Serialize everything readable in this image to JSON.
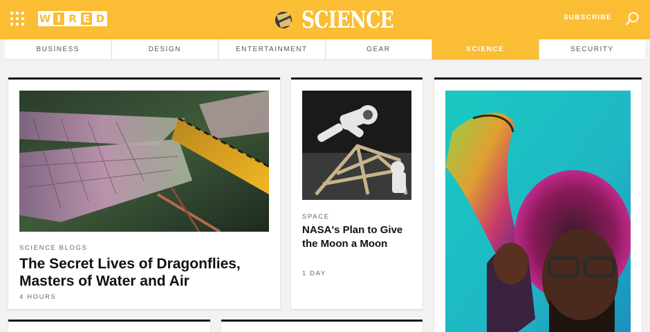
{
  "header": {
    "brand_letters": [
      "W",
      "I",
      "R",
      "E",
      "D"
    ],
    "section_title": "SCIENCE",
    "subscribe_label": "SUBSCRIBE",
    "brand_color": "#fbbd33"
  },
  "nav": {
    "items": [
      {
        "label": "BUSINESS"
      },
      {
        "label": "DESIGN"
      },
      {
        "label": "ENTERTAINMENT"
      },
      {
        "label": "GEAR"
      },
      {
        "label": "SCIENCE",
        "active": true
      },
      {
        "label": "SECURITY"
      }
    ]
  },
  "cards": [
    {
      "kicker": "SCIENCE BLOGS",
      "headline": "The Secret Lives of Dragonflies, Masters of Water and Air",
      "meta": "4 HOURS",
      "image": "dragonfly-closeup"
    },
    {
      "kicker": "SPACE",
      "headline": "NASA's Plan to Give the Moon a Moon",
      "meta": "1 DAY",
      "image": "astronaut-on-lunar-frame"
    },
    {
      "image": "musician-with-gramophone-horn"
    }
  ]
}
